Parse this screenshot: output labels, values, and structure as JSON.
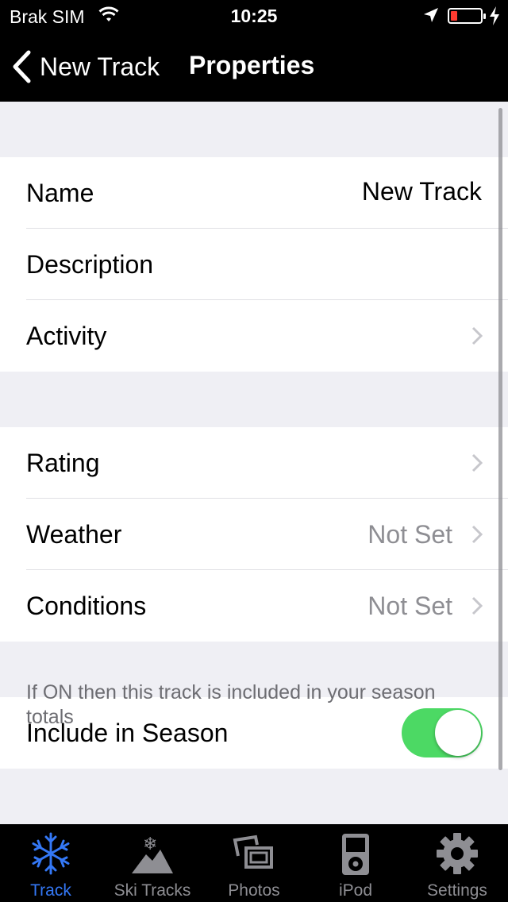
{
  "status_bar": {
    "carrier": "Brak SIM",
    "time": "10:25"
  },
  "nav": {
    "back_label": "New Track",
    "title": "Properties"
  },
  "section1": [
    {
      "label": "Name",
      "value": "New Track"
    },
    {
      "label": "Description",
      "value": ""
    },
    {
      "label": "Activity",
      "value": ""
    }
  ],
  "section2": [
    {
      "label": "Rating",
      "value": ""
    },
    {
      "label": "Weather",
      "value": "Not Set"
    },
    {
      "label": "Conditions",
      "value": "Not Set"
    }
  ],
  "section3": {
    "label": "Include in Season",
    "toggle_on": true
  },
  "footnote": "If ON then this track is included in your season totals",
  "tabs": [
    {
      "label": "Track",
      "icon": "snowflake-icon",
      "active": true
    },
    {
      "label": "Ski Tracks",
      "icon": "mountain-icon",
      "active": false
    },
    {
      "label": "Photos",
      "icon": "photos-icon",
      "active": false
    },
    {
      "label": "iPod",
      "icon": "ipod-icon",
      "active": false
    },
    {
      "label": "Settings",
      "icon": "gear-icon",
      "active": false
    }
  ],
  "colors": {
    "accent": "#3478f6",
    "toggle_on": "#4cd964",
    "battery_low": "#ff3b30",
    "muted": "#8e8e93"
  }
}
